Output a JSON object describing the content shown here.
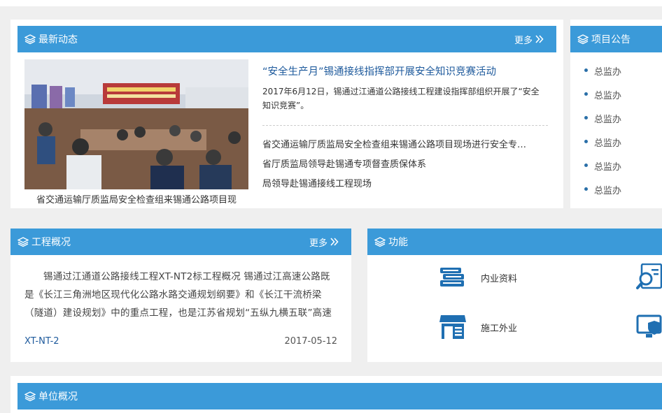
{
  "news": {
    "title": "最新动态",
    "more": "更多",
    "photo_caption": "省交通运输厅质监局安全检查组来锡通公路项目现",
    "headline": "“安全生产月”锡通接线指挥部开展安全知识竞赛活动",
    "summary": "2017年6月12日，锡通过江通道公路接线工程建设指挥部组织开展了“安全知识竞赛”。",
    "items": [
      "省交通运输厅质监局安全检查组来锡通公路项目现场进行安全专…",
      "省厅质监局领导赴锡通专项督查质保体系",
      "局领导赴锡通接线工程现场"
    ]
  },
  "announcements": {
    "title": "项目公告",
    "items": [
      "总监办",
      "总监办",
      "总监办",
      "总监办",
      "总监办",
      "总监办"
    ]
  },
  "overview": {
    "title": "工程概况",
    "more": "更多",
    "text": "锡通过江通道公路接线工程XT-NT2标工程概况 锡通过江高速公路既是《长江三角洲地区现代化公路水路交通规划纲要》和《长江干流桥梁（隧道）建设规划》中的重点工程，也是江苏省规划“五纵九横五联”高速",
    "code": "XT-NT-2",
    "date": "2017-05-12"
  },
  "functions": {
    "title": "功能",
    "items": [
      "内业资料",
      "施工外业"
    ]
  },
  "units": {
    "title": "单位概况"
  },
  "colors": {
    "accent": "#3b9ad9",
    "link": "#1e5a9c",
    "icon": "#1f6fb2"
  }
}
